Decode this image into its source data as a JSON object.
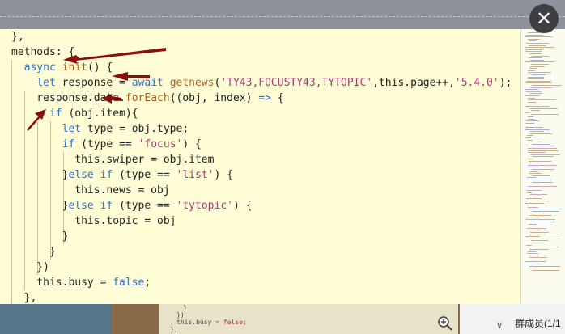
{
  "viewer": {
    "close_glyph": "✕",
    "code_lines": [
      [
        {
          "t": "},",
          "c": ""
        }
      ],
      [
        {
          "t": "methods: {",
          "c": ""
        }
      ],
      [
        {
          "t": "  ",
          "c": ""
        },
        {
          "t": "async",
          "c": "k"
        },
        {
          "t": " ",
          "c": ""
        },
        {
          "t": "init",
          "c": "f"
        },
        {
          "t": "() {",
          "c": ""
        }
      ],
      [
        {
          "t": "    ",
          "c": ""
        },
        {
          "t": "let",
          "c": "k"
        },
        {
          "t": " response = ",
          "c": ""
        },
        {
          "t": "await",
          "c": "k"
        },
        {
          "t": " ",
          "c": ""
        },
        {
          "t": "getnews",
          "c": "f"
        },
        {
          "t": "(",
          "c": ""
        },
        {
          "t": "'TY43,FOCUSTY43,TYTOPIC'",
          "c": "s"
        },
        {
          "t": ",this.page++,",
          "c": ""
        },
        {
          "t": "'5.4.0'",
          "c": "s"
        },
        {
          "t": ");",
          "c": ""
        }
      ],
      [
        {
          "t": "    response.data.",
          "c": ""
        },
        {
          "t": "forEach",
          "c": "f"
        },
        {
          "t": "((obj, index) ",
          "c": ""
        },
        {
          "t": "=>",
          "c": "k"
        },
        {
          "t": " {",
          "c": ""
        }
      ],
      [
        {
          "t": "      ",
          "c": ""
        },
        {
          "t": "if",
          "c": "k"
        },
        {
          "t": " (obj.item){",
          "c": ""
        }
      ],
      [
        {
          "t": "        ",
          "c": ""
        },
        {
          "t": "let",
          "c": "k"
        },
        {
          "t": " type = obj.type;",
          "c": ""
        }
      ],
      [
        {
          "t": "        ",
          "c": ""
        },
        {
          "t": "if",
          "c": "k"
        },
        {
          "t": " (type == ",
          "c": ""
        },
        {
          "t": "'focus'",
          "c": "s"
        },
        {
          "t": ") {",
          "c": ""
        }
      ],
      [
        {
          "t": "          this.swiper = obj.item",
          "c": ""
        }
      ],
      [
        {
          "t": "        }",
          "c": ""
        },
        {
          "t": "else",
          "c": "k"
        },
        {
          "t": " ",
          "c": ""
        },
        {
          "t": "if",
          "c": "k"
        },
        {
          "t": " (type == ",
          "c": ""
        },
        {
          "t": "'list'",
          "c": "s"
        },
        {
          "t": ") {",
          "c": ""
        }
      ],
      [
        {
          "t": "          this.news = obj",
          "c": ""
        }
      ],
      [
        {
          "t": "        }",
          "c": ""
        },
        {
          "t": "else",
          "c": "k"
        },
        {
          "t": " ",
          "c": ""
        },
        {
          "t": "if",
          "c": "k"
        },
        {
          "t": " (type == ",
          "c": ""
        },
        {
          "t": "'tytopic'",
          "c": "s"
        },
        {
          "t": ") {",
          "c": ""
        }
      ],
      [
        {
          "t": "          this.topic = obj",
          "c": ""
        }
      ],
      [
        {
          "t": "        }",
          "c": ""
        }
      ],
      [
        {
          "t": "      }",
          "c": ""
        }
      ],
      [
        {
          "t": "    })",
          "c": ""
        }
      ],
      [
        {
          "t": "    this.busy = ",
          "c": ""
        },
        {
          "t": "false",
          "c": "k"
        },
        {
          "t": ";",
          "c": ""
        }
      ],
      [
        {
          "t": "  },",
          "c": ""
        }
      ]
    ]
  },
  "background": {
    "code_lines": [
      [
        {
          "t": "}",
          "c": ""
        }
      ],
      [
        {
          "t": "})",
          "c": ""
        }
      ],
      [
        {
          "t": "this.busy = ",
          "c": ""
        },
        {
          "t": "false",
          "c": "kw"
        },
        {
          "t": ";",
          "c": ""
        }
      ],
      [
        {
          "t": "},",
          "c": ""
        }
      ]
    ]
  },
  "members": {
    "label": "群成员(1/1",
    "chevron": "∨"
  },
  "colors": {
    "keyword": "#2f6fd6",
    "function": "#b0601c",
    "string": "#a33d73",
    "arrow": "#8b0f0f",
    "viewer_bg": "#fefdd6"
  }
}
